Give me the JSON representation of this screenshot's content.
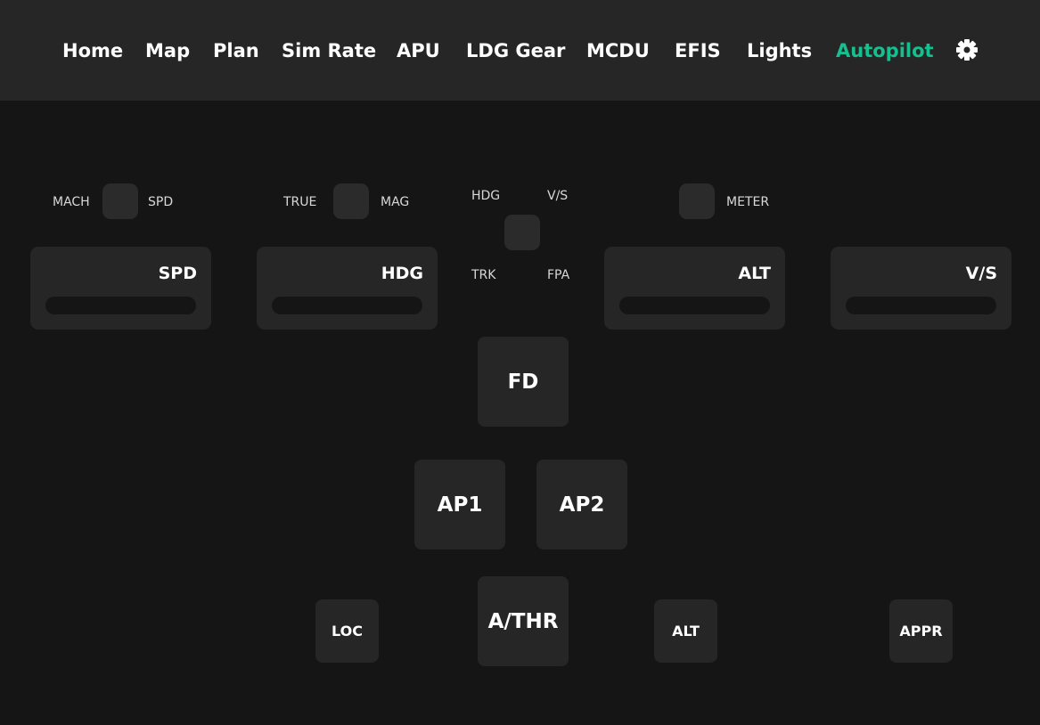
{
  "nav": {
    "items": [
      {
        "label": "Home"
      },
      {
        "label": "Map"
      },
      {
        "label": "Plan"
      },
      {
        "label": "Sim Rate"
      },
      {
        "label": "APU"
      },
      {
        "label": "LDG Gear"
      },
      {
        "label": "MCDU"
      },
      {
        "label": "EFIS"
      },
      {
        "label": "Lights"
      },
      {
        "label": "Autopilot",
        "active": true
      }
    ],
    "settings_icon": "gear-icon"
  },
  "toggles": {
    "mach_label": "MACH",
    "spd_label": "SPD",
    "true_label": "TRUE",
    "mag_label": "MAG",
    "hdg_label": "HDG",
    "vs_label": "V/S",
    "trk_label": "TRK",
    "fpa_label": "FPA",
    "meter_label": "METER"
  },
  "panels": {
    "spd": "SPD",
    "hdg": "HDG",
    "alt": "ALT",
    "vs": "V/S"
  },
  "buttons": {
    "fd": "FD",
    "ap1": "AP1",
    "ap2": "AP2",
    "athr": "A/THR",
    "loc": "LOC",
    "alt": "ALT",
    "appr": "APPR"
  },
  "colors": {
    "background": "#151515",
    "surface": "#262626",
    "accent": "#14c08f",
    "text": "#ffffff"
  }
}
